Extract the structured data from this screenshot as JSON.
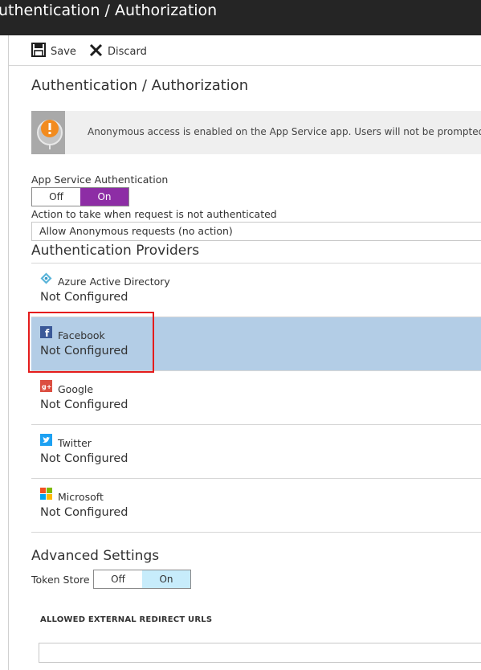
{
  "window": {
    "title": "uthentication / Authorization"
  },
  "toolbar": {
    "save_label": "Save",
    "discard_label": "Discard"
  },
  "page": {
    "heading": "Authentication / Authorization"
  },
  "banner": {
    "message": "Anonymous access is enabled on the App Service app. Users will not be prompted fo"
  },
  "auth": {
    "label": "App Service Authentication",
    "off_label": "Off",
    "on_label": "On",
    "selected": "On"
  },
  "action": {
    "label": "Action to take when request is not authenticated",
    "value": "Allow Anonymous requests (no action)"
  },
  "providers": {
    "heading": "Authentication Providers",
    "items": [
      {
        "name": "Azure Active Directory",
        "status": "Not Configured",
        "icon": "azure-ad-icon"
      },
      {
        "name": "Facebook",
        "status": "Not Configured",
        "icon": "facebook-icon",
        "selected": true
      },
      {
        "name": "Google",
        "status": "Not Configured",
        "icon": "google-plus-icon"
      },
      {
        "name": "Twitter",
        "status": "Not Configured",
        "icon": "twitter-icon"
      },
      {
        "name": "Microsoft",
        "status": "Not Configured",
        "icon": "microsoft-icon"
      }
    ]
  },
  "advanced": {
    "heading": "Advanced Settings",
    "token_store_label": "Token Store",
    "off_label": "Off",
    "on_label": "On",
    "selected": "On"
  },
  "redirect": {
    "label": "ALLOWED EXTERNAL REDIRECT URLS",
    "value": ""
  },
  "colors": {
    "accent_purple": "#8d2da5",
    "selected_row": "#b3cde6",
    "highlight_red": "#e41c1c",
    "token_on": "#c7ecfb"
  }
}
